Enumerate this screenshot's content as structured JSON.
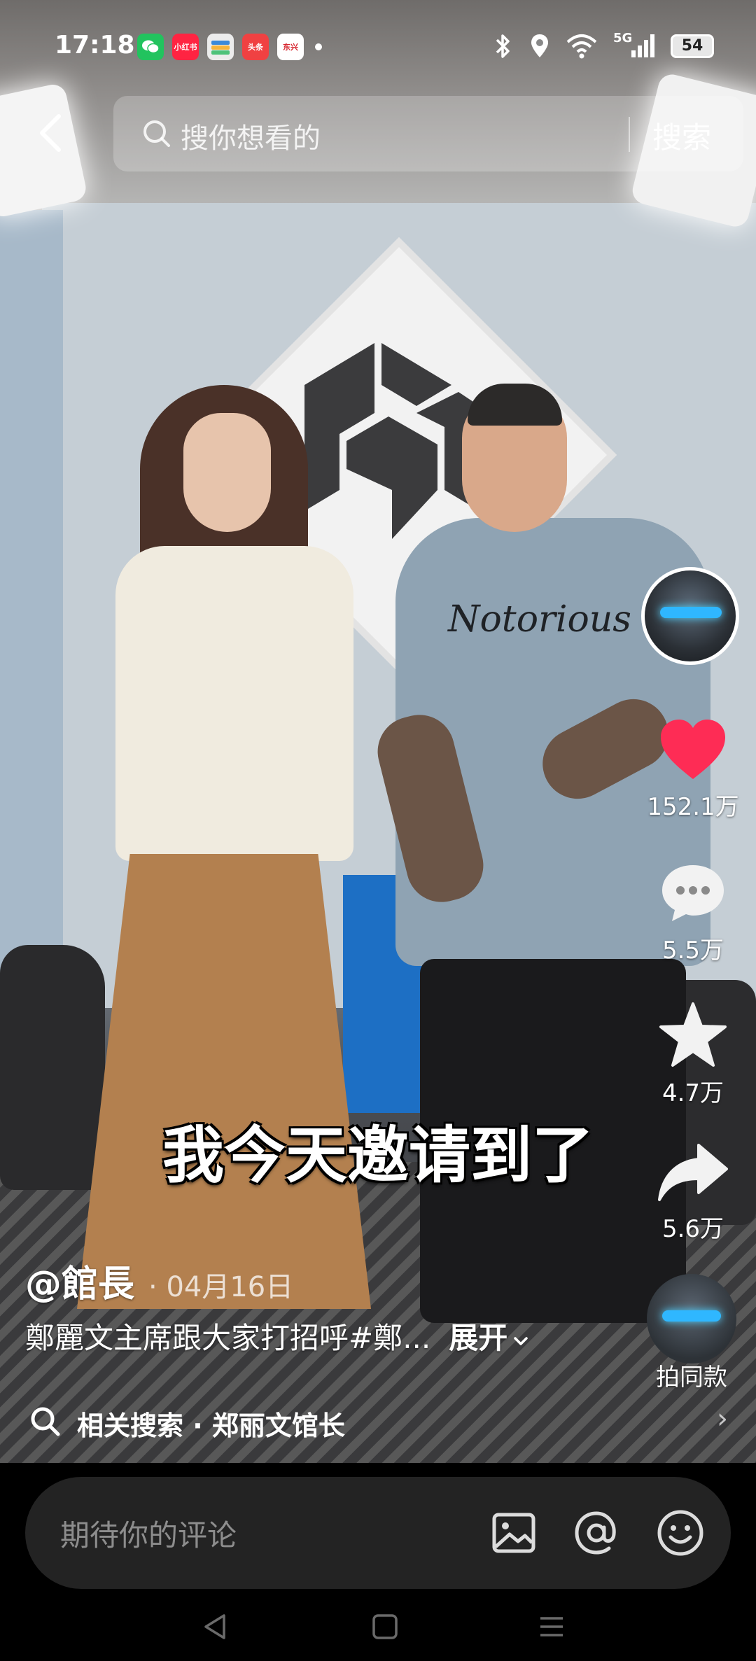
{
  "status_bar": {
    "time": "17:18",
    "apps": [
      {
        "name": "wechat-icon",
        "label": "",
        "color": "#22c35e"
      },
      {
        "name": "xiaohongshu-icon",
        "label": "小红书",
        "color": "#ff2442"
      },
      {
        "name": "wallet-icon",
        "label": "",
        "color": "#3b8ad9"
      },
      {
        "name": "toutiao-icon",
        "label": "头条",
        "color": "#f04142"
      },
      {
        "name": "dongfang-icon",
        "label": "东兴",
        "color": "#d7262f"
      }
    ],
    "network": "5G",
    "battery": "54"
  },
  "search": {
    "placeholder": "搜你想看的",
    "button": "搜索"
  },
  "video": {
    "subtitle": "我今天邀请到了",
    "shirt_text": "Notorious"
  },
  "actions": {
    "likes": "152.1万",
    "comments": "5.5万",
    "favorites": "4.7万",
    "shares": "5.6万",
    "remix": "拍同款",
    "like_color": "#fe2c55"
  },
  "post": {
    "author": "@館長",
    "date": "· 04月16日",
    "caption": "鄭麗文主席跟大家打招呼#鄭...",
    "expand": "展开"
  },
  "related_search": {
    "text": "相关搜索 · 郑丽文馆长"
  },
  "comment": {
    "placeholder": "期待你的评论"
  }
}
